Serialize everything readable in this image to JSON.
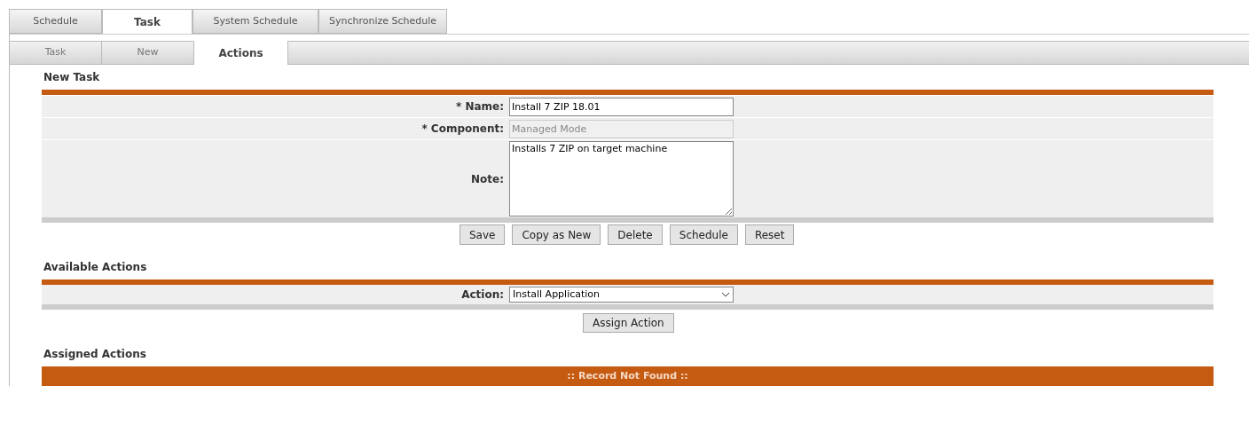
{
  "tabs": [
    {
      "label": "Schedule",
      "selected": false
    },
    {
      "label": "Task",
      "selected": true
    },
    {
      "label": "System Schedule",
      "selected": false
    },
    {
      "label": "Synchronize Schedule",
      "selected": false
    }
  ],
  "subtabs": [
    {
      "label": "Task",
      "selected": false
    },
    {
      "label": "New",
      "selected": false
    },
    {
      "label": "Actions",
      "selected": true
    }
  ],
  "new_task": {
    "title": "New Task",
    "fields": [
      {
        "kind": "input",
        "label": "* Name:",
        "value": "Install 7 ZIP 18.01",
        "disabled": false
      },
      {
        "kind": "input",
        "label": "* Component:",
        "value": "Managed Mode",
        "disabled": true
      },
      {
        "kind": "textarea",
        "label": "Note:",
        "value": "Installs 7 ZIP on target machine",
        "disabled": false
      }
    ],
    "buttons": [
      "Save",
      "Copy as New",
      "Delete",
      "Schedule",
      "Reset"
    ]
  },
  "available_actions": {
    "title": "Available Actions",
    "field": {
      "label": "Action:",
      "value": "Install Application"
    },
    "button": "Assign Action"
  },
  "assigned_actions": {
    "title": "Assigned Actions",
    "message": ":: Record Not Found ::"
  }
}
